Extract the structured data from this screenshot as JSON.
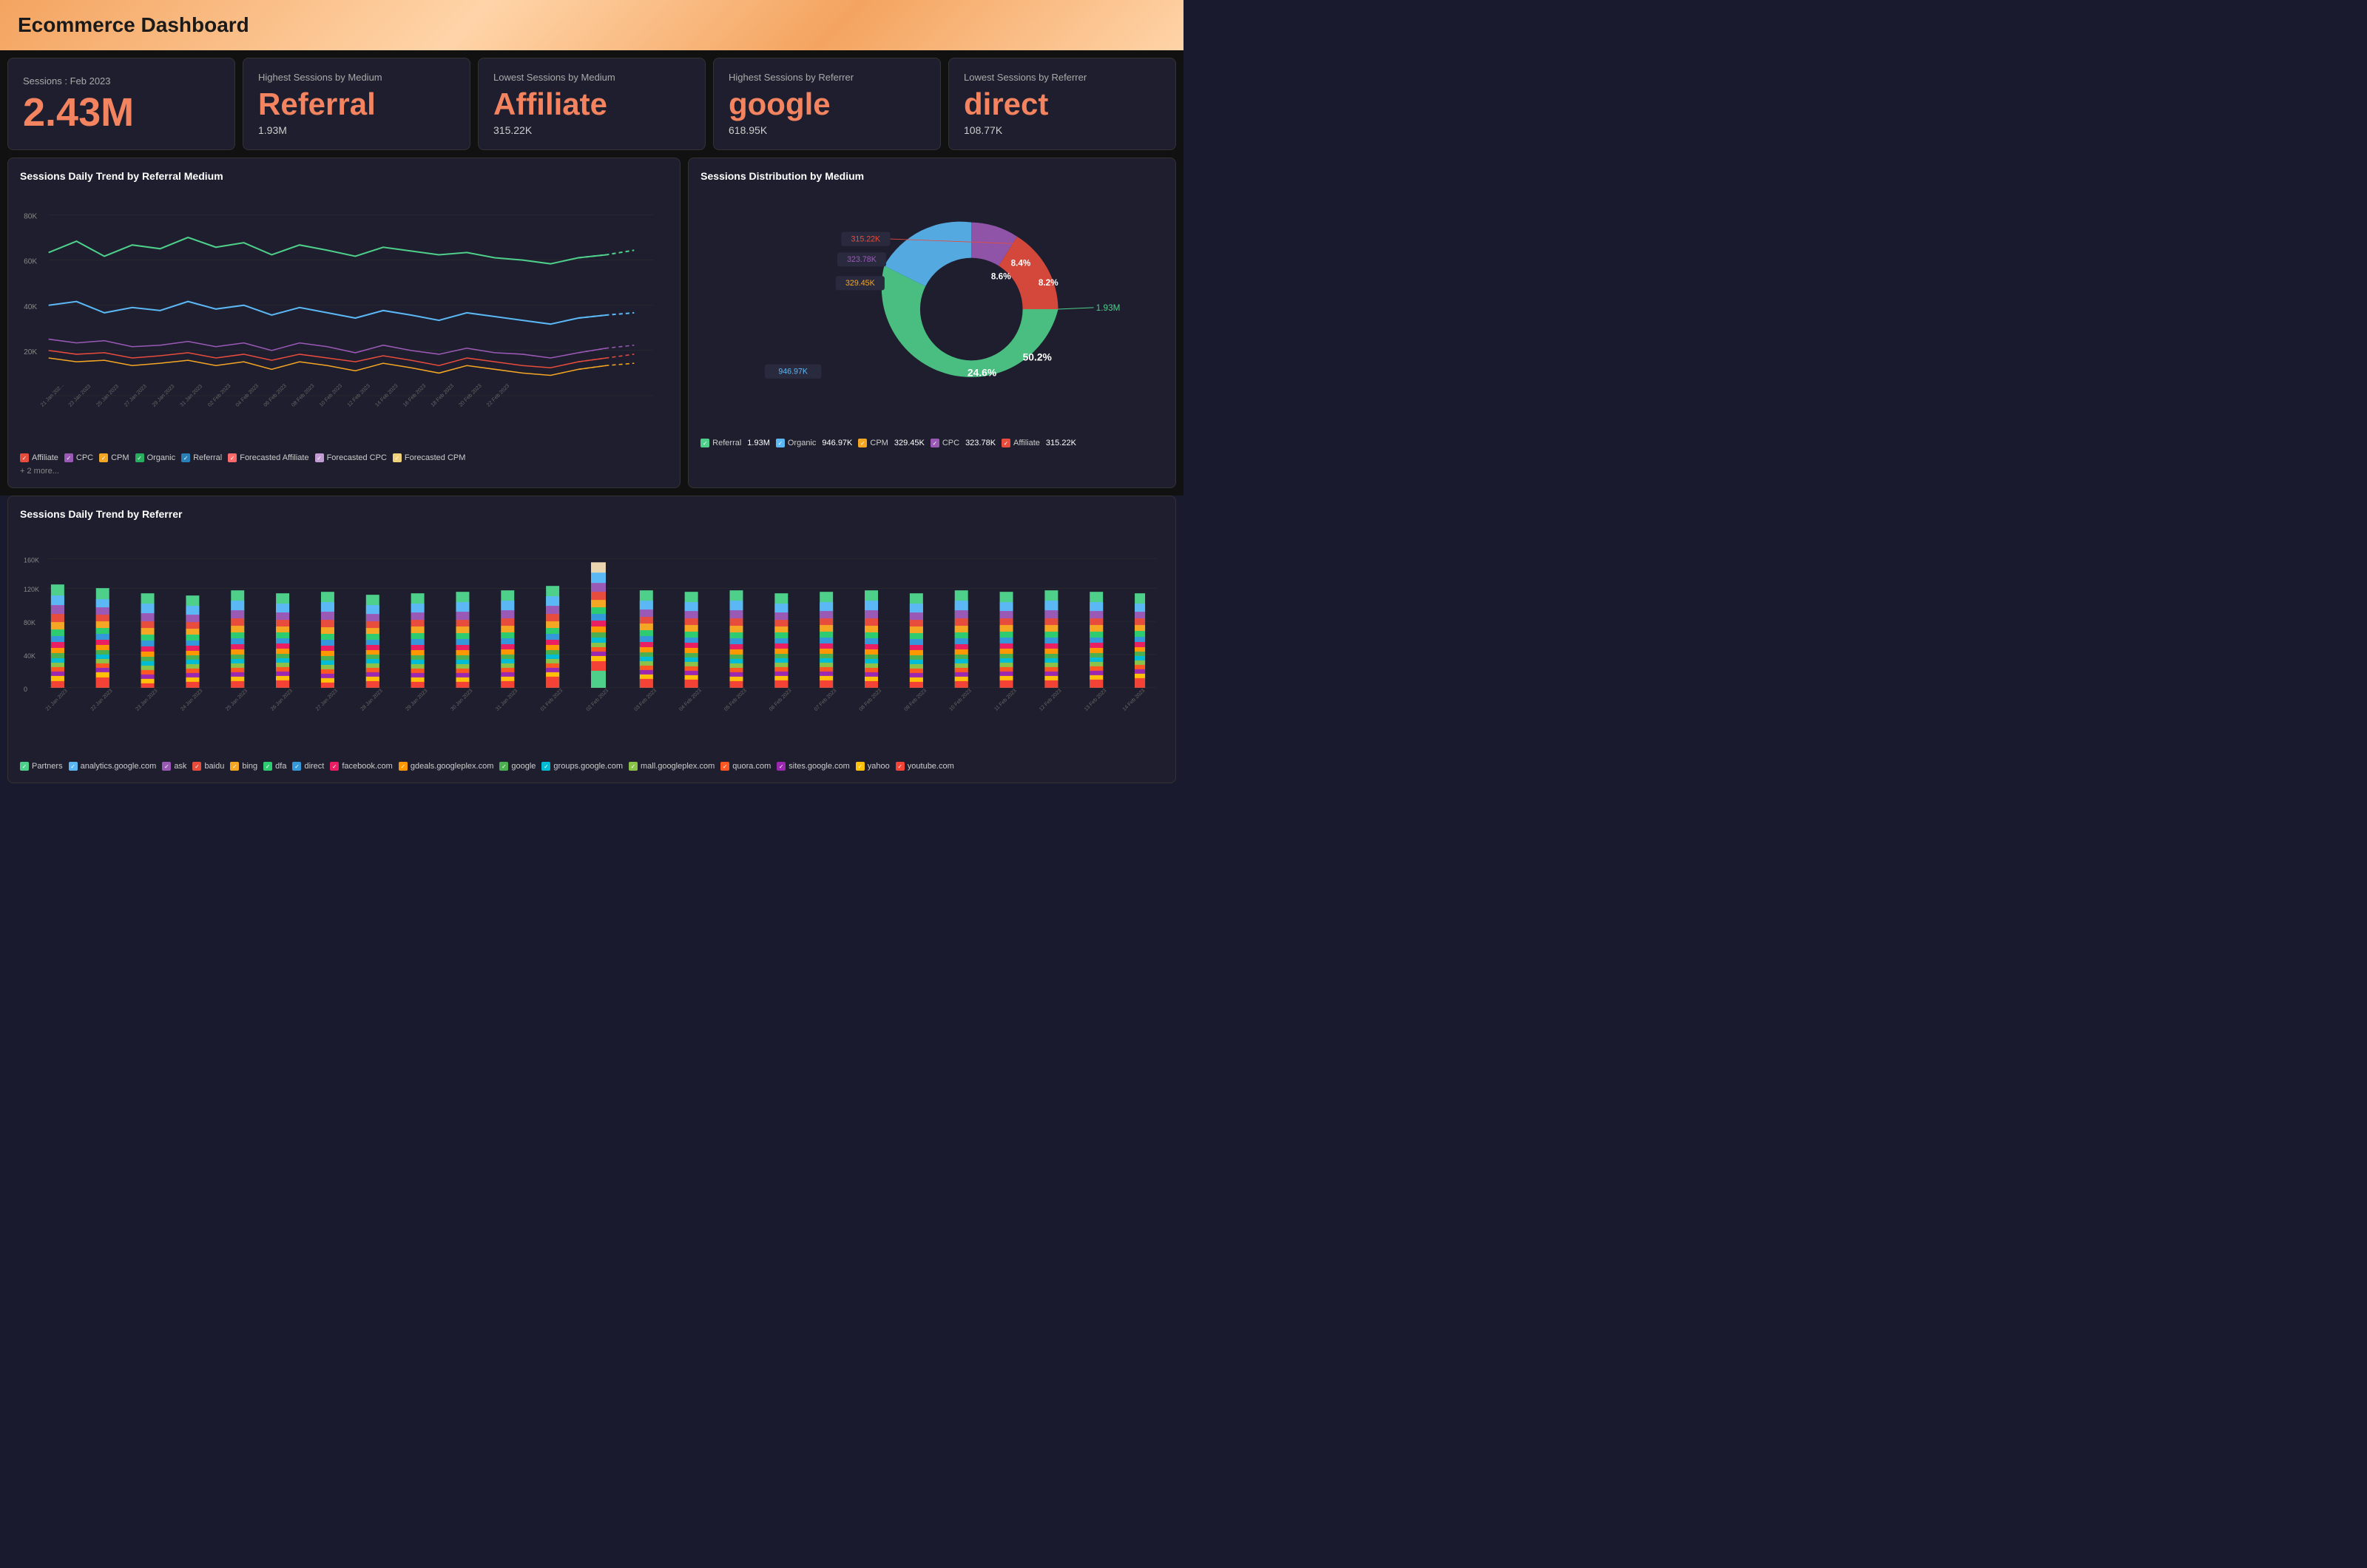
{
  "header": {
    "title": "Ecommerce Dashboard"
  },
  "kpis": [
    {
      "label": "Sessions : Feb 2023",
      "value": "2.43M",
      "sub": "",
      "valueSize": "large"
    },
    {
      "label": "Highest Sessions by Medium",
      "value": "Referral",
      "sub": "1.93M",
      "valueSize": "normal"
    },
    {
      "label": "Lowest Sessions by Medium",
      "value": "Affiliate",
      "sub": "315.22K",
      "valueSize": "normal"
    },
    {
      "label": "Highest Sessions by Referrer",
      "value": "google",
      "sub": "618.95K",
      "valueSize": "normal"
    },
    {
      "label": "Lowest Sessions by Referrer",
      "value": "direct",
      "sub": "108.77K",
      "valueSize": "normal"
    }
  ],
  "lineChartTitle": "Sessions Daily Trend by Referral Medium",
  "donutChartTitle": "Sessions Distribution by Medium",
  "barChartTitle": "Sessions Daily Trend by Referrer",
  "donutData": [
    {
      "label": "Referral",
      "value": "1.93M",
      "color": "#4ecf8a",
      "pct": 50.2
    },
    {
      "label": "Organic",
      "value": "946.97K",
      "color": "#5bb8f5",
      "pct": 24.6
    },
    {
      "label": "CPM",
      "value": "329.45K",
      "color": "#f5a623",
      "pct": 8.6
    },
    {
      "label": "CPC",
      "value": "323.78K",
      "color": "#9b59b6",
      "pct": 8.4
    },
    {
      "label": "Affiliate",
      "value": "315.22K",
      "color": "#e74c3c",
      "pct": 8.2
    }
  ],
  "lineLegend": [
    {
      "label": "Affiliate",
      "color": "#e74c3c"
    },
    {
      "label": "CPC",
      "color": "#9b59b6"
    },
    {
      "label": "CPM",
      "color": "#f5a623"
    },
    {
      "label": "Organic",
      "color": "#27ae60"
    },
    {
      "label": "Referral",
      "color": "#2980b9"
    },
    {
      "label": "Forecasted Affiliate",
      "color": "#ff6b6b"
    },
    {
      "label": "Forecasted CPC",
      "color": "#c39bd3"
    },
    {
      "label": "Forecasted CPM",
      "color": "#f0d27a"
    }
  ],
  "barLegend": [
    {
      "label": "Partners",
      "color": "#4ecf8a"
    },
    {
      "label": "analytics.google.com",
      "color": "#5bb8f5"
    },
    {
      "label": "ask",
      "color": "#9b59b6"
    },
    {
      "label": "baidu",
      "color": "#e74c3c"
    },
    {
      "label": "bing",
      "color": "#f5a623"
    },
    {
      "label": "dfa",
      "color": "#2ecc71"
    },
    {
      "label": "direct",
      "color": "#3498db"
    },
    {
      "label": "facebook.com",
      "color": "#e91e63"
    },
    {
      "label": "gdeals.googleplex.com",
      "color": "#ff9800"
    },
    {
      "label": "google",
      "color": "#4caf50"
    },
    {
      "label": "groups.google.com",
      "color": "#00bcd4"
    },
    {
      "label": "mall.googleplex.com",
      "color": "#8bc34a"
    },
    {
      "label": "quora.com",
      "color": "#ff5722"
    },
    {
      "label": "sites.google.com",
      "color": "#9c27b0"
    },
    {
      "label": "yahoo",
      "color": "#ffc107"
    },
    {
      "label": "youtube.com",
      "color": "#f44336"
    }
  ],
  "moreLabel": "+ 2 more..."
}
